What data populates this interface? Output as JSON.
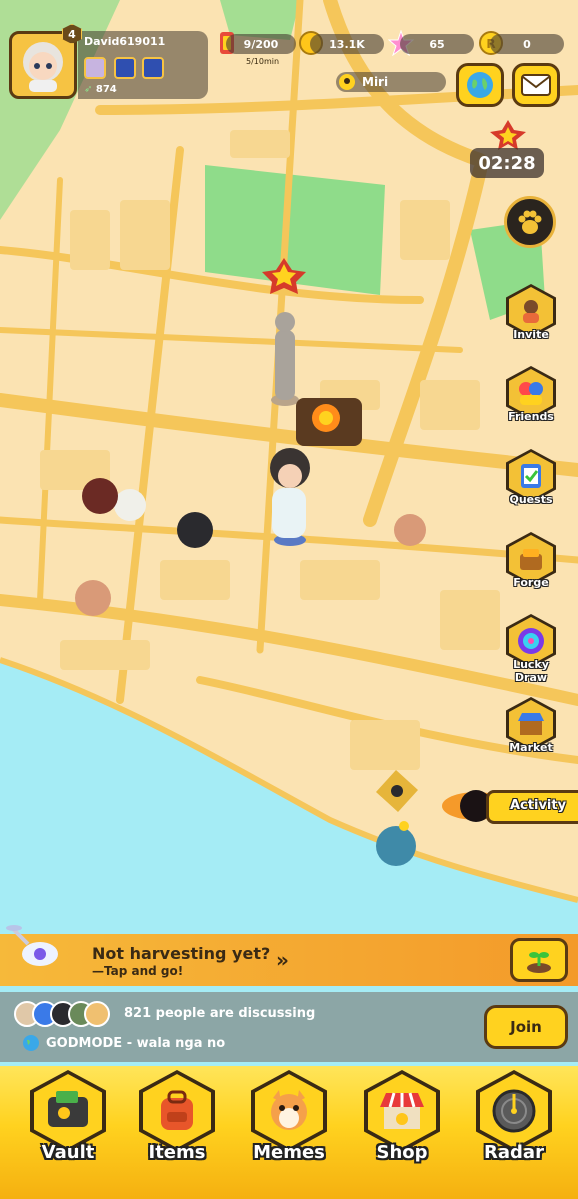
{
  "player": {
    "level": "4",
    "username": "David619011",
    "power": "874"
  },
  "stats": {
    "energy": "9/200",
    "energy_rate": "5/10min",
    "coins": "13.1K",
    "stars": "65",
    "gold": "0"
  },
  "location": {
    "city": "Miri"
  },
  "event": {
    "timer": "02:28"
  },
  "side_menu": [
    {
      "label": "Invite",
      "icon": "invite-icon"
    },
    {
      "label": "Friends",
      "icon": "friends-icon"
    },
    {
      "label": "Quests",
      "icon": "quests-icon"
    },
    {
      "label": "Forge",
      "icon": "forge-icon"
    },
    {
      "label": "Lucky Draw",
      "icon": "lucky-draw-icon"
    },
    {
      "label": "Market",
      "icon": "market-icon"
    }
  ],
  "activity": {
    "label": "Activity"
  },
  "harvest": {
    "title": "Not harvesting yet?",
    "subtitle": "—Tap and go!",
    "arrow": "»"
  },
  "chat": {
    "discussing": "821 people are discussing",
    "last_message": "GODMODE - wala nga no",
    "join_label": "Join"
  },
  "bottom_nav": [
    {
      "label": "Vault",
      "icon": "vault-icon"
    },
    {
      "label": "Items",
      "icon": "items-icon"
    },
    {
      "label": "Memes",
      "icon": "memes-icon"
    },
    {
      "label": "Shop",
      "icon": "shop-icon"
    },
    {
      "label": "Radar",
      "icon": "radar-icon"
    }
  ],
  "colors": {
    "map_land": "#fbe3b2",
    "map_road": "#f5c65a",
    "map_park": "#8fdc8a",
    "map_water": "#a5ecf5",
    "accent": "#ffd21f"
  }
}
